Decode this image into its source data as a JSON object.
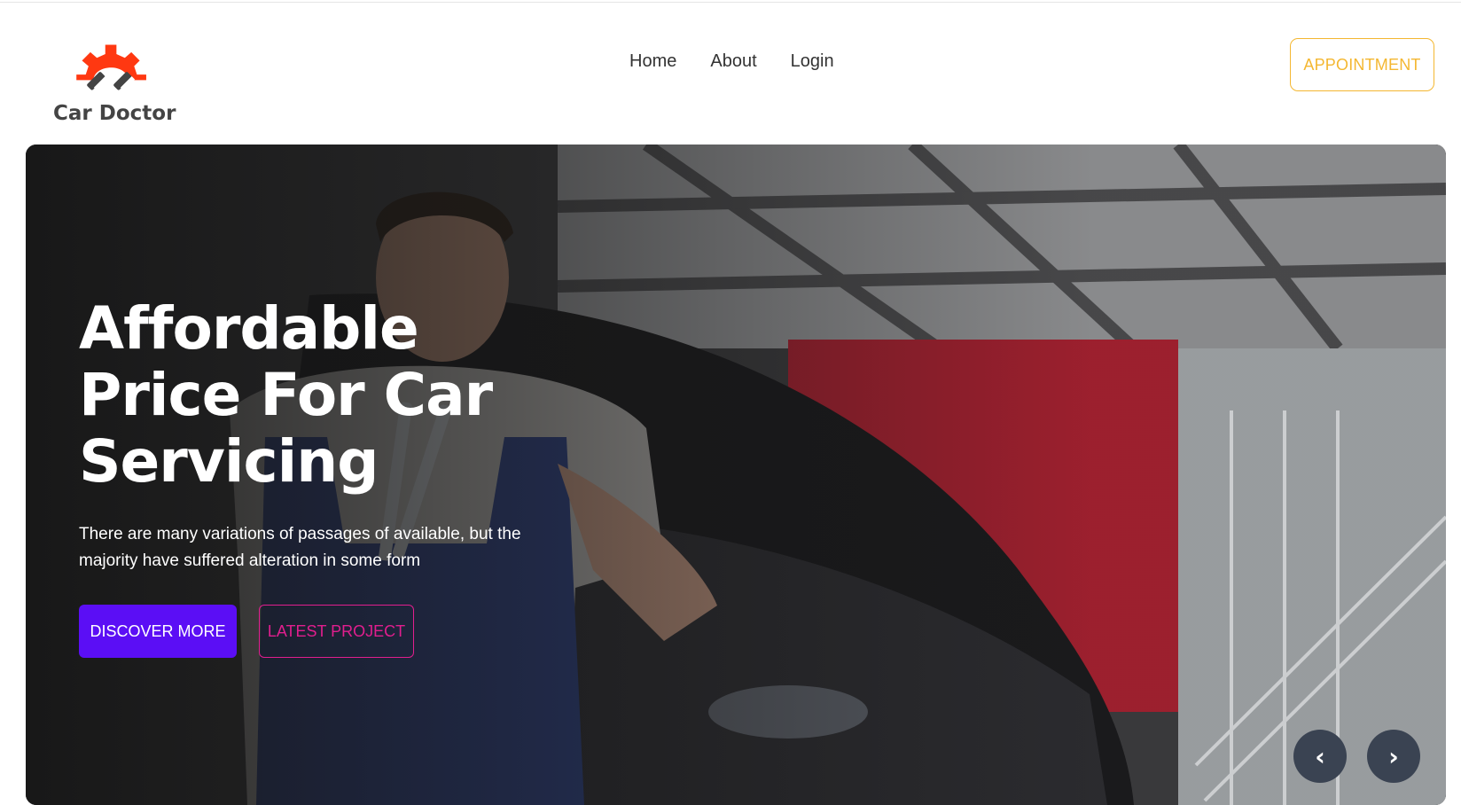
{
  "brand": {
    "name": "Car Doctor",
    "logo_icon": "gear-pistons-icon",
    "accent": "#ff3811"
  },
  "nav": {
    "items": [
      "Home",
      "About",
      "Login"
    ]
  },
  "appointment": {
    "label": "APPOINTMENT",
    "color": "#f4b731"
  },
  "hero": {
    "title": "Affordable Price For Car Servicing",
    "description": "There are many variations of passages of available, but the majority have suffered alteration in some form",
    "primary_button": "DISCOVER MORE",
    "secondary_button": "LATEST PROJECT",
    "primary_color": "#5b0ef5",
    "secondary_color": "#e11e8e",
    "prev_icon": "‹",
    "next_icon": "›"
  }
}
